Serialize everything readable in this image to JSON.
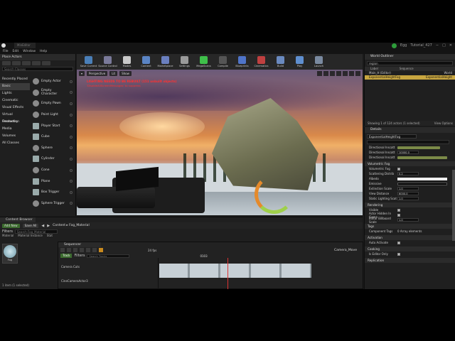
{
  "titlebar": {
    "project_tab": "MinEditor",
    "right_items": [
      "Egg",
      "Tutorial_427"
    ],
    "window_controls": [
      "−",
      "□",
      "✕"
    ]
  },
  "menu": [
    "File",
    "Edit",
    "Window",
    "Help"
  ],
  "modes": {
    "tab": "Place Actors",
    "search_placeholder": "Search Classes",
    "categories": [
      "Recently Placed",
      "Basic",
      "Lights",
      "Cinematic",
      "Visual Effects",
      "Virtual Production",
      "Geometry",
      "Media",
      "Volumes",
      "All Classes"
    ],
    "items": [
      "Empty Actor",
      "Empty Character",
      "Empty Pawn",
      "Point Light",
      "Player Start",
      "Cube",
      "Sphere",
      "Cylinder",
      "Cone",
      "Plane",
      "Box Trigger",
      "Sphere Trigger"
    ]
  },
  "toolbar": {
    "buttons": [
      {
        "label": "Save Current",
        "color": "#4a7fb8"
      },
      {
        "label": "Source Control",
        "color": "#7a7a9a"
      },
      {
        "label": "Modes",
        "color": "#c9c9c9"
      },
      {
        "label": "Content",
        "color": "#5a84c4"
      },
      {
        "label": "Marketplace",
        "color": "#6a7fbf"
      },
      {
        "label": "Settings",
        "color": "#9a9a9a"
      },
      {
        "label": "MegaScans",
        "color": "#3fbf4a"
      },
      {
        "label": "Compile",
        "color": "#555555"
      },
      {
        "label": "Blueprints",
        "color": "#4f74c9"
      },
      {
        "label": "Cinematics",
        "color": "#c04040"
      },
      {
        "label": "Build",
        "color": "#6a8ac0"
      },
      {
        "label": "Play",
        "color": "#5f8fd0"
      },
      {
        "label": "Launch",
        "color": "#7a8aa0"
      }
    ]
  },
  "viewport": {
    "buttons": [
      "Perspective",
      "Lit",
      "Show"
    ],
    "warning": "LIGHTING NEEDS TO BE REBUILT (151 unbuilt objects)",
    "subwarning": "'DisableAllScreenMessages' to suppress"
  },
  "outliner": {
    "tab": "World Outliner",
    "search_value": "region",
    "col_label": "Label",
    "col_type": "Sequence",
    "rows": [
      {
        "label": "Main_H (Editor)",
        "type": "World",
        "selected": false
      },
      {
        "label": "ExponentialHeightFog",
        "type": "ExponentialHeight",
        "selected": true
      }
    ],
    "footer_count": "Showing 1 of 124 actors (1 selected)",
    "footer_options": "View Options"
  },
  "details": {
    "tab": "Details",
    "actor_name": "ExponentialHeightFog",
    "rows_top": [
      {
        "label": "Directional Inscatt",
        "value": ""
      },
      {
        "label": "Directional Inscatt",
        "value": "10000.0"
      },
      {
        "label": "Directional Inscatt",
        "value": ""
      }
    ],
    "sec_vol": "Volumetric Fog",
    "vol_rows": [
      {
        "label": "Volumetric Fog",
        "value": ""
      },
      {
        "label": "Scattering Distrib",
        "value": "0.2"
      },
      {
        "label": "Albedo",
        "value": ""
      },
      {
        "label": "Emissive",
        "value": ""
      },
      {
        "label": "Extinction Scale",
        "value": "1.0"
      },
      {
        "label": "View Distance",
        "value": "6000.0"
      },
      {
        "label": "Static Lighting Scat",
        "value": "1.0"
      }
    ],
    "sec_render": "Rendering",
    "render_rows": [
      {
        "label": "Visible",
        "value": ""
      },
      {
        "label": "Actor Hidden In Game",
        "value": ""
      },
      {
        "label": "Editor Billboard Scale",
        "value": "1.0"
      }
    ],
    "sec_tags": "Tags",
    "tags_label": "Component Tags",
    "tags_value": "0 Array elements",
    "sec_activation": "Activation",
    "activation_label": "Auto Activate",
    "sec_cooking": "Cooking",
    "cooking_label": "Is Editor Only",
    "sec_replication": "Replication"
  },
  "content_browser": {
    "tab": "Content Browser",
    "add_new": "Add New",
    "save_all": "Save All",
    "path": "Content ▸ Fog_Material",
    "filters": "Filters",
    "search_placeholder": "Search Fog_Material",
    "tabs": [
      "Material",
      "Material Instance",
      "Stat"
    ],
    "asset_label": "Fog",
    "count": "1 item (1 selected)"
  },
  "sequencer": {
    "tab": "Sequencer",
    "fps": "24 fps",
    "shot": "Camera_Move",
    "track_btn": "Track",
    "filters": "Filters",
    "search_placeholder": "Search Tracks",
    "time": "0103",
    "tracks": [
      "Camera Cuts",
      "CineCameraActor3"
    ]
  }
}
